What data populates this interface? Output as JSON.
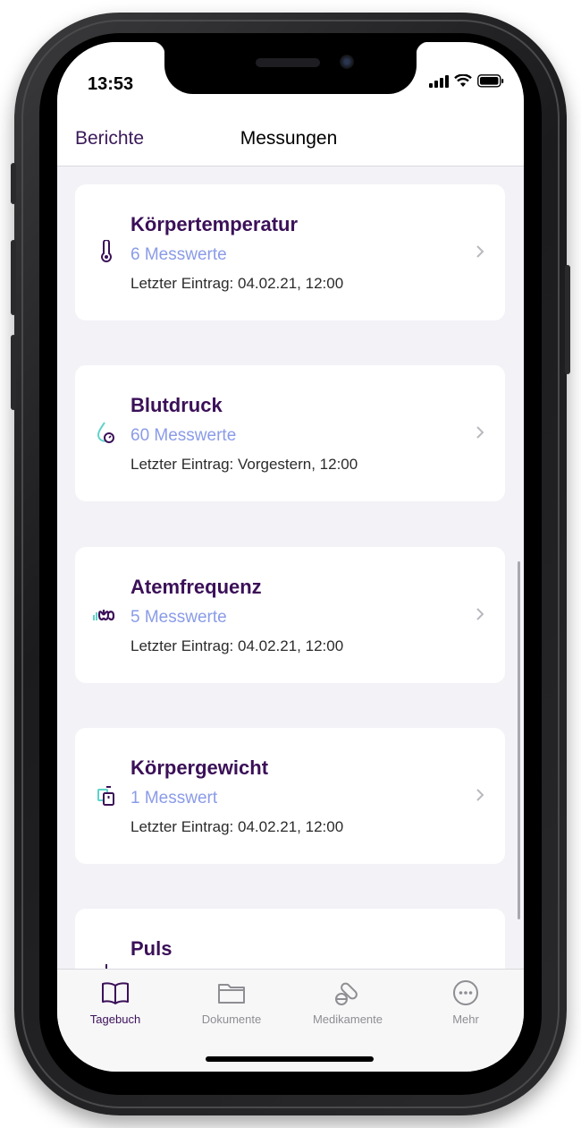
{
  "status_bar": {
    "time": "13:53"
  },
  "nav": {
    "back_label": "Berichte",
    "title": "Messungen"
  },
  "measurements": [
    {
      "title": "Körpertemperatur",
      "count": "6 Messwerte",
      "last_entry": "Letzter Eintrag: 04.02.21, 12:00",
      "icon": "thermometer-icon"
    },
    {
      "title": "Blutdruck",
      "count": "60 Messwerte",
      "last_entry": "Letzter Eintrag: Vorgestern, 12:00",
      "icon": "blood-drop-gauge-icon"
    },
    {
      "title": "Atemfrequenz",
      "count": "5 Messwerte",
      "last_entry": "Letzter Eintrag: 04.02.21, 12:00",
      "icon": "lungs-icon"
    },
    {
      "title": "Körpergewicht",
      "count": "1 Messwert",
      "last_entry": "Letzter Eintrag: 04.02.21, 12:00",
      "icon": "scale-icon"
    },
    {
      "title": "Puls",
      "count": "",
      "last_entry": "",
      "icon": "pulse-icon"
    }
  ],
  "tabbar": {
    "items": [
      {
        "label": "Tagebuch",
        "icon": "book-icon",
        "active": true
      },
      {
        "label": "Dokumente",
        "icon": "folder-icon",
        "active": false
      },
      {
        "label": "Medikamente",
        "icon": "pills-icon",
        "active": false
      },
      {
        "label": "Mehr",
        "icon": "more-icon",
        "active": false
      }
    ]
  },
  "colors": {
    "accent": "#3b1058",
    "secondary": "#8a9be8",
    "icon_teal": "#5fd3c8",
    "background": "#f2f2f7"
  }
}
